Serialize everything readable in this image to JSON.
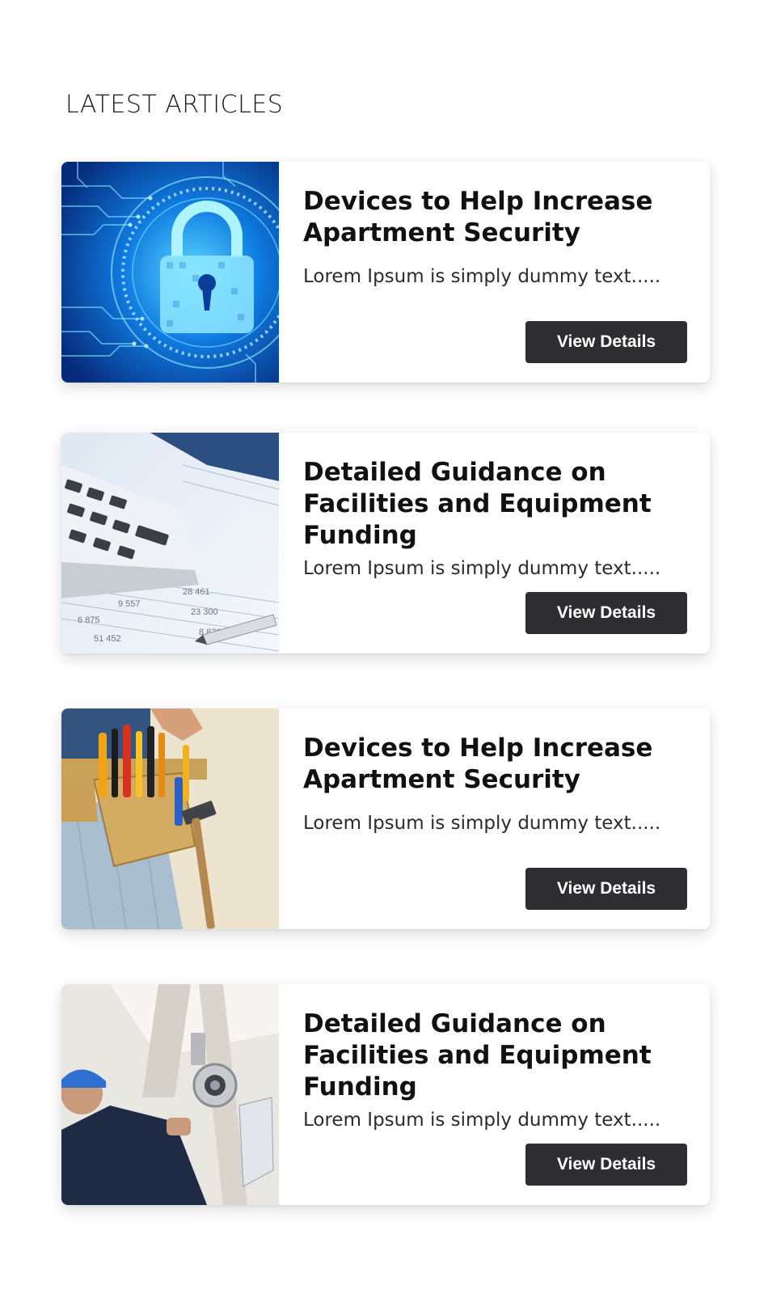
{
  "section": {
    "title": "LATEST ARTICLES"
  },
  "articles": [
    {
      "title": "Devices to Help Increase Apartment Security",
      "excerpt": "Lorem Ipsum is simply dummy text.....",
      "button_label": "View Details",
      "image_icon": "digital-padlock-image"
    },
    {
      "title": "Detailed Guidance on Facilities and Equipment Funding",
      "excerpt": "Lorem Ipsum is simply dummy text.....",
      "button_label": "View Details",
      "image_icon": "calculator-spreadsheet-image"
    },
    {
      "title": "Devices to Help Increase Apartment Security",
      "excerpt": "Lorem Ipsum is simply dummy text.....",
      "button_label": "View Details",
      "image_icon": "tool-belt-image"
    },
    {
      "title": "Detailed Guidance on Facilities and Equipment Funding",
      "excerpt": "Lorem Ipsum is simply dummy text.....",
      "button_label": "View Details",
      "image_icon": "technician-cctv-camera-image"
    }
  ],
  "colors": {
    "button_bg": "#2e2d32",
    "button_text": "#ffffff",
    "title_text": "#111111"
  }
}
